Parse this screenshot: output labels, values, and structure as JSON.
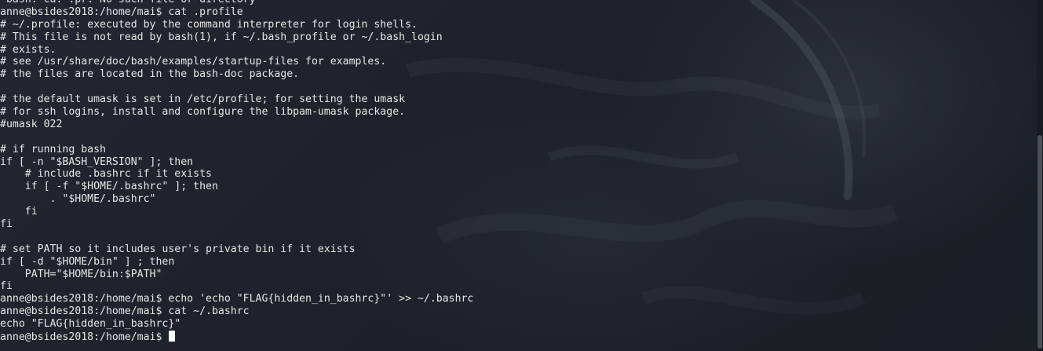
{
  "terminal": {
    "lines": [
      "-bash: cd: .pr: No such file or directory",
      "anne@bsides2018:/home/mai$ cat .profile",
      "# ~/.profile: executed by the command interpreter for login shells.",
      "# This file is not read by bash(1), if ~/.bash_profile or ~/.bash_login",
      "# exists.",
      "# see /usr/share/doc/bash/examples/startup-files for examples.",
      "# the files are located in the bash-doc package.",
      "",
      "# the default umask is set in /etc/profile; for setting the umask",
      "# for ssh logins, install and configure the libpam-umask package.",
      "#umask 022",
      "",
      "# if running bash",
      "if [ -n \"$BASH_VERSION\" ]; then",
      "    # include .bashrc if it exists",
      "    if [ -f \"$HOME/.bashrc\" ]; then",
      "        . \"$HOME/.bashrc\"",
      "    fi",
      "fi",
      "",
      "# set PATH so it includes user's private bin if it exists",
      "if [ -d \"$HOME/bin\" ] ; then",
      "    PATH=\"$HOME/bin:$PATH\"",
      "fi",
      "anne@bsides2018:/home/mai$ echo 'echo \"FLAG{hidden_in_bashrc}\"' >> ~/.bashrc",
      "anne@bsides2018:/home/mai$ cat ~/.bashrc",
      "echo \"FLAG{hidden_in_bashrc}\""
    ],
    "prompt": "anne@bsides2018:/home/mai$ "
  },
  "colors": {
    "background": "#1e2229",
    "foreground": "#e6e6e6",
    "cursor": "#ffffff",
    "scrollbar_thumb": "#4a505a"
  }
}
